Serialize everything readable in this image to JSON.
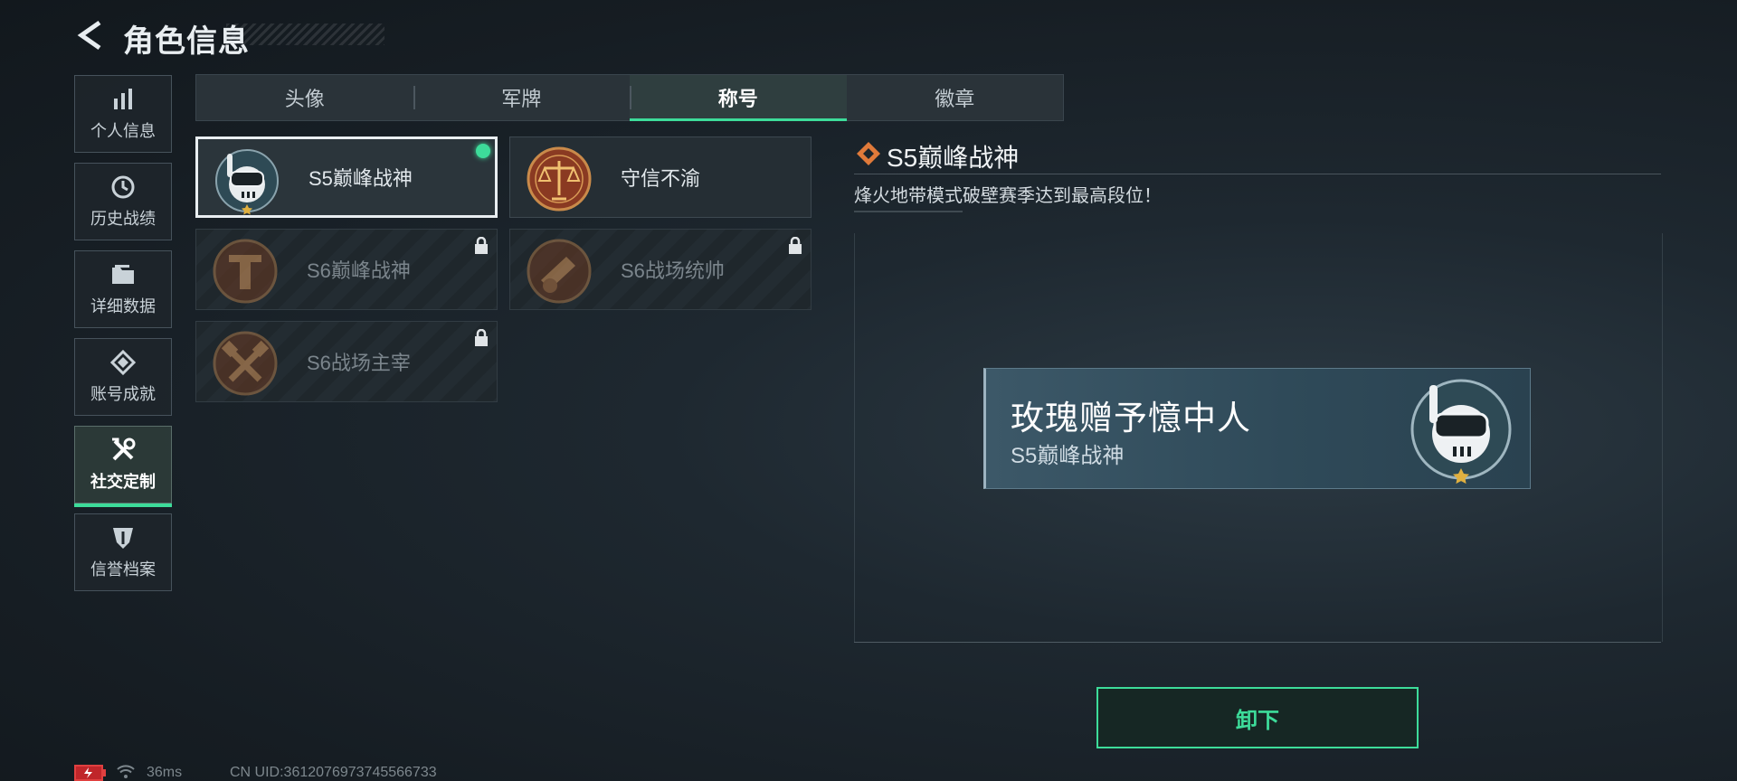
{
  "header": {
    "title": "角色信息"
  },
  "sidebar": {
    "items": [
      {
        "label": "个人信息",
        "icon": "bar-chart-icon"
      },
      {
        "label": "历史战绩",
        "icon": "history-icon"
      },
      {
        "label": "详细数据",
        "icon": "folder-icon"
      },
      {
        "label": "账号成就",
        "icon": "achievement-icon"
      },
      {
        "label": "社交定制",
        "icon": "tools-icon",
        "active": true
      },
      {
        "label": "信誉档案",
        "icon": "shield-icon"
      }
    ]
  },
  "tabs": [
    {
      "label": "头像"
    },
    {
      "label": "军牌"
    },
    {
      "label": "称号",
      "active": true
    },
    {
      "label": "徽章"
    }
  ],
  "titles": [
    {
      "name": "S5巅峰战神",
      "emblem": "diver-skull-emblem",
      "selected": true,
      "equipped": true,
      "locked": false
    },
    {
      "name": "守信不渝",
      "emblem": "scales-emblem",
      "selected": false,
      "locked": false
    },
    {
      "name": "S6巅峰战神",
      "emblem": "gate-emblem",
      "locked": true
    },
    {
      "name": "S6战场统帅",
      "emblem": "cannon-emblem",
      "locked": true
    },
    {
      "name": "S6战场主宰",
      "emblem": "crossed-hammers-emblem",
      "locked": true
    }
  ],
  "detail": {
    "title": "S5巅峰战神",
    "description": "烽火地带模式破壁赛季达到最高段位！"
  },
  "preview": {
    "player_name": "玫瑰赠予憶中人",
    "title": "S5巅峰战神"
  },
  "action": {
    "unequip_label": "卸下"
  },
  "footer": {
    "ping": "36ms",
    "uid": "CN UID:3612076973745566733"
  },
  "colors": {
    "accent": "#3ddc9a",
    "detail_icon": "#e07a3a"
  }
}
